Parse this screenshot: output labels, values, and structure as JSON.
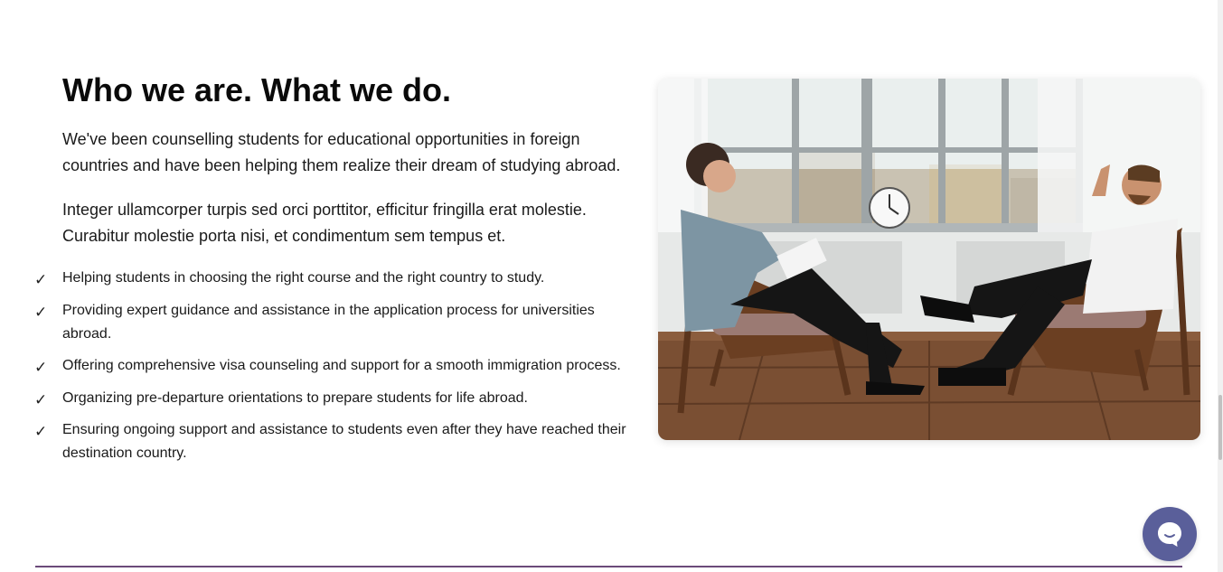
{
  "about": {
    "heading": "Who we are. What we do.",
    "paragraphs": [
      "We've been counselling students for educational opportunities in foreign countries and have been helping them realize their dream of studying abroad.",
      "Integer ullamcorper turpis sed orci porttitor, efficitur fringilla erat molestie. Curabitur molestie porta nisi, et condimentum sem tempus et."
    ],
    "check_glyph": "✓",
    "features": [
      "Helping students in choosing the right course and the right country to study.",
      "Providing expert guidance and assistance in the application process for universities abroad.",
      "Offering comprehensive visa counseling and support for a smooth immigration process.",
      "Organizing pre-departure orientations to prepare students for life abroad.",
      "Ensuring ongoing support and assistance to students even after they have reached their destination country."
    ]
  },
  "chat": {
    "icon": "chat-bubble-icon",
    "color": "#5a5f9a"
  },
  "colors": {
    "divider": "#6b4a7a"
  }
}
